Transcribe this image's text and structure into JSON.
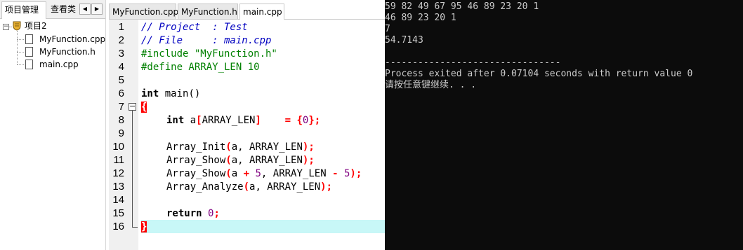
{
  "project_panel": {
    "tabs": [
      "项目管理",
      "查看类"
    ],
    "tree": {
      "project_name": "项目2",
      "files": [
        "MyFunction.cpp",
        "MyFunction.h",
        "main.cpp"
      ]
    }
  },
  "editor": {
    "tabs": [
      "MyFunction.cpp",
      "MyFunction.h",
      "main.cpp"
    ],
    "active_tab": "main.cpp",
    "line_numbers": [
      "1",
      "2",
      "3",
      "4",
      "5",
      "6",
      "7",
      "8",
      "9",
      "10",
      "11",
      "12",
      "13",
      "14",
      "15",
      "16"
    ],
    "code": {
      "l1": "// Project  : Test",
      "l2": "// File     : main.cpp",
      "l3": "#include \"MyFunction.h\"",
      "l4": "#define ARRAY_LEN 10",
      "l6_kw": "int",
      "l6_rest": " main()",
      "l7_brace": "{",
      "l8_kw": "int",
      "l8_a": " a",
      "l8_lb": "[",
      "l8_mid": "ARRAY_LEN",
      "l8_rb": "]",
      "l8_sp": "    ",
      "l8_eq": "=",
      "l8_sp2": " ",
      "l8_lbrace": "{",
      "l8_num": "0",
      "l8_rbrace": "}",
      "l8_semi": ";",
      "l10_fn": "Array_Init",
      "l10_lp": "(",
      "l10_args": "a, ARRAY_LEN",
      "l10_rp": ")",
      "l10_semi": ";",
      "l11_fn": "Array_Show",
      "l11_lp": "(",
      "l11_args": "a, ARRAY_LEN",
      "l11_rp": ")",
      "l11_semi": ";",
      "l12_fn": "Array_Show",
      "l12_lp": "(",
      "l12_a": "a ",
      "l12_plus": "+",
      "l12_sp": " ",
      "l12_five": "5",
      "l12_mid": ", ARRAY_LEN ",
      "l12_minus": "-",
      "l12_sp2": " ",
      "l12_five2": "5",
      "l12_rp": ")",
      "l12_semi": ";",
      "l13_fn": "Array_Analyze",
      "l13_lp": "(",
      "l13_args": "a, ARRAY_LEN",
      "l13_rp": ")",
      "l13_semi": ";",
      "l15_kw": "return",
      "l15_sp": " ",
      "l15_num": "0",
      "l15_semi": ";",
      "l16_brace": "}"
    }
  },
  "console": {
    "lines": [
      "59 82 49 67 95 46 89 23 20 1",
      "46 89 23 20 1",
      "7",
      "54.7143",
      "",
      "--------------------------------",
      "Process exited after 0.07104 seconds with return value 0",
      "请按任意键继续. . ."
    ]
  },
  "colors": {
    "console_bg": "#0c0c0c",
    "console_text": "#cccccc",
    "current_line": "#c8f7f7",
    "comment": "#0000c0",
    "preprocessor": "#008000",
    "operator": "#ff0000",
    "number": "#800080"
  }
}
